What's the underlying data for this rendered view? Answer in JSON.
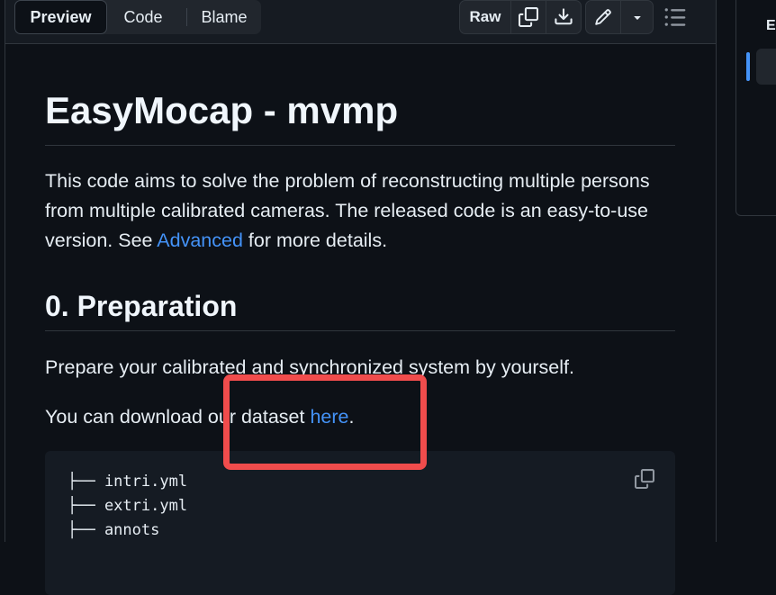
{
  "tabs": [
    {
      "label": "Preview",
      "active": true
    },
    {
      "label": "Code",
      "active": false
    },
    {
      "label": "Blame",
      "active": false
    }
  ],
  "toolbar": {
    "raw_label": "Raw",
    "icons": [
      "copy-icon",
      "download-icon",
      "pencil-icon",
      "triangle-down-icon",
      "list-unordered-icon"
    ]
  },
  "readme": {
    "title": "EasyMocap - mvmp",
    "intro_before_link": "This code aims to solve the problem of reconstructing multiple persons from multiple calibrated cameras. The released code is an easy-to-use version. See ",
    "intro_link": "Advanced",
    "intro_after_link": " for more details.",
    "section_heading": "0. Preparation",
    "prep_text": "Prepare your calibrated and synchronized system by yourself.",
    "download_before_link": "You can download our dataset ",
    "download_link": "here",
    "download_after_link": ".",
    "code_lines": [
      "├── intri.yml",
      "├── extri.yml",
      "├── annots"
    ]
  },
  "side_panel": {
    "label": "E"
  },
  "colors": {
    "background": "#0d1117",
    "link": "#4493f8",
    "highlight_box": "#f04c4c"
  }
}
